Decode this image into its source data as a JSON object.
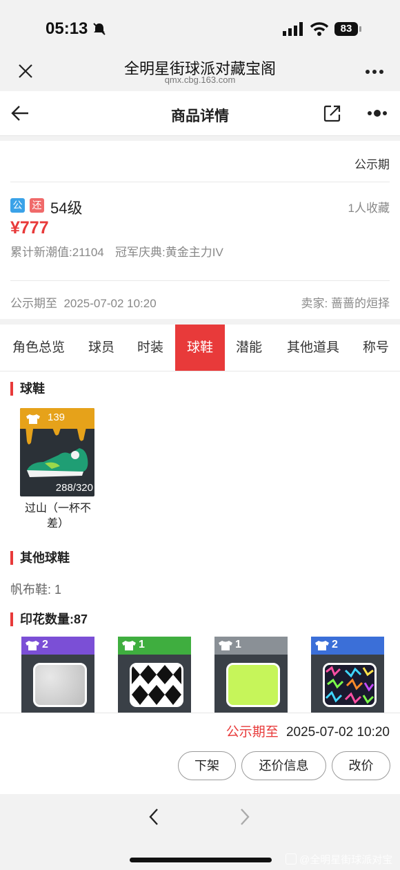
{
  "status_bar": {
    "time": "05:13",
    "battery": "83"
  },
  "browser": {
    "title": "全明星街球派对藏宝阁",
    "url": "qmx.cbg.163.com"
  },
  "page_header": {
    "title": "商品详情"
  },
  "info": {
    "phase": "公示期",
    "tag_public": "公",
    "tag_bargain": "还",
    "level": "54级",
    "favorites": "1人收藏",
    "price": "¥777",
    "stat1": "累计新潮值:21104",
    "stat2": "冠军庆典:黄金主力IV",
    "public_until": "公示期至  2025-07-02 10:20",
    "seller": "卖家: 蔷蔷的烜择"
  },
  "tabs": [
    "角色总览",
    "球员",
    "时装",
    "球鞋",
    "潜能",
    "其他道具",
    "称号"
  ],
  "active_tab": "球鞋",
  "shoes": {
    "section": "球鞋",
    "item": {
      "count": "139",
      "progress": "288/320",
      "name_line1": "过山（一杯不",
      "name_line2": "差）"
    }
  },
  "other_shoes": {
    "section": "其他球鞋",
    "text": "帆布鞋: 1"
  },
  "prints": {
    "section": "印花数量:87",
    "items": [
      {
        "count": "2",
        "band": "#7b4fd6"
      },
      {
        "count": "1",
        "band": "#3fae3f"
      },
      {
        "count": "1",
        "band": "#8a9096"
      },
      {
        "count": "2",
        "band": "#3b6fd8"
      }
    ]
  },
  "bottom": {
    "label": "公示期至",
    "datetime": "2025-07-02 10:20",
    "buttons": [
      "下架",
      "还价信息",
      "改价"
    ]
  },
  "watermark": "@全明星街球派对宝"
}
